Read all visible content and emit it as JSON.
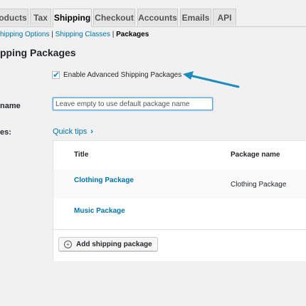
{
  "tabs": [
    {
      "label": "oducts"
    },
    {
      "label": "Tax"
    },
    {
      "label": "Shipping"
    },
    {
      "label": "Checkout"
    },
    {
      "label": "Accounts"
    },
    {
      "label": "Emails"
    },
    {
      "label": "API"
    }
  ],
  "active_tab": "Shipping",
  "subnav": {
    "shipping_options": "hipping Options",
    "separator": "|",
    "shipping_classes": "Shipping Classes",
    "packages": "Packages"
  },
  "section_heading": "pping Packages",
  "enable": {
    "label": "Enable Advanced Shipping Packages",
    "checked": true
  },
  "name_field": {
    "label": "name",
    "placeholder": "Leave empty to use default package name",
    "value": ""
  },
  "packages_row_label": "es:",
  "quick_tips": {
    "label": "Quick tips",
    "chevron": "›"
  },
  "table": {
    "headers": {
      "title": "Title",
      "package_name": "Package name"
    },
    "rows": [
      {
        "title": "Clothing Package",
        "package_name": "Clothing Package"
      },
      {
        "title": "Music Package",
        "package_name": ""
      }
    ]
  },
  "add_button": {
    "label": "Add shipping package",
    "icon": "plus-circle-icon"
  },
  "colors": {
    "link": "#0073aa",
    "arrow": "#1e8cbe",
    "background": "#f1f1f1"
  }
}
